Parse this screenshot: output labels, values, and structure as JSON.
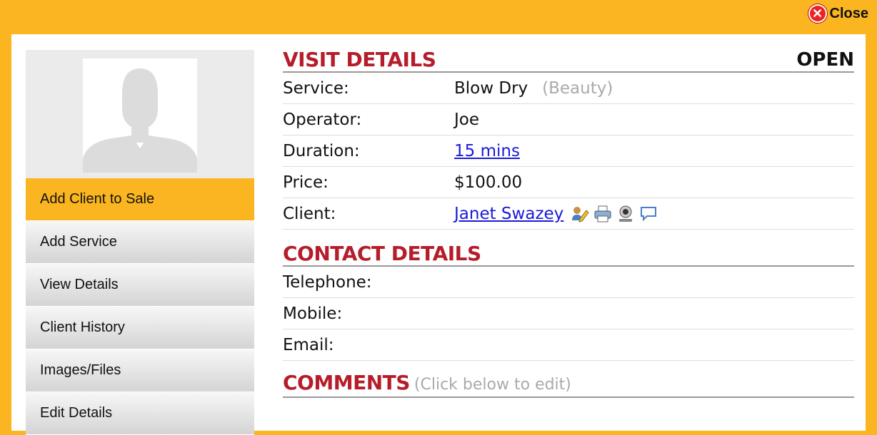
{
  "header": {
    "close_label": "Close"
  },
  "sidebar": {
    "items": [
      {
        "label": "Add Client to Sale",
        "active": true
      },
      {
        "label": "Add Service"
      },
      {
        "label": "View Details"
      },
      {
        "label": "Client History"
      },
      {
        "label": "Images/Files"
      },
      {
        "label": "Edit Details"
      }
    ]
  },
  "visit": {
    "title": "VISIT DETAILS",
    "status": "OPEN",
    "service_label": "Service:",
    "service_value": "Blow Dry",
    "service_category": "(Beauty)",
    "operator_label": "Operator:",
    "operator_value": "Joe",
    "duration_label": "Duration:",
    "duration_value": "15 mins",
    "price_label": "Price:",
    "price_value": "$100.00",
    "client_label": "Client:",
    "client_value": "Janet Swazey",
    "client_icons": [
      "edit-user-icon",
      "print-icon",
      "webcam-icon",
      "comment-icon"
    ]
  },
  "contact": {
    "title": "CONTACT DETAILS",
    "telephone_label": "Telephone:",
    "mobile_label": "Mobile:",
    "email_label": "Email:"
  },
  "comments": {
    "title": "COMMENTS",
    "hint": "(Click below to edit)"
  },
  "colors": {
    "accent": "#fbb520",
    "heading": "#b51d2a",
    "link": "#1a1ad6"
  }
}
